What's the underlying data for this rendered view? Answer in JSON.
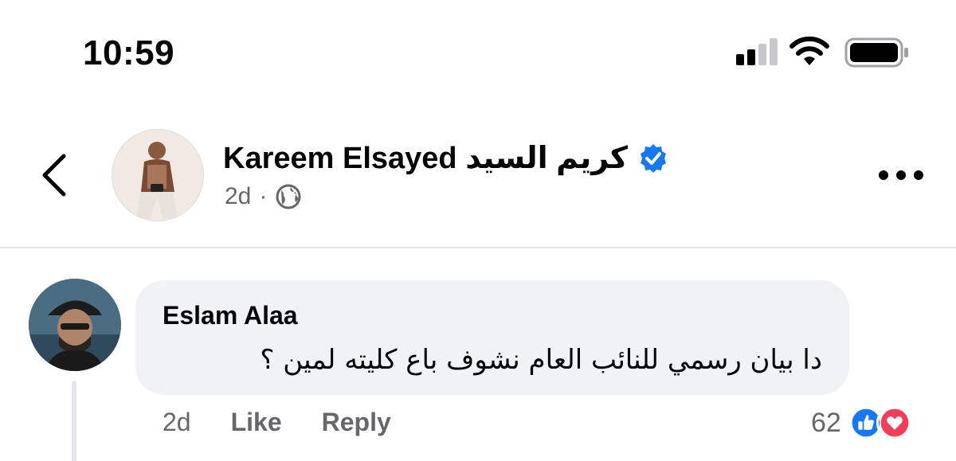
{
  "status_bar": {
    "time": "10:59"
  },
  "post": {
    "author_name": "Kareem Elsayed كريم  السيد",
    "timestamp": "2d",
    "separator": "·",
    "privacy_icon": "globe-icon",
    "verified_icon": "verified-badge-icon"
  },
  "comment": {
    "author_name": "Eslam Alaa",
    "text": "دا بيان رسمي للنائب العام نشوف باع كليته لمين ؟",
    "timestamp": "2d",
    "like_label": "Like",
    "reply_label": "Reply",
    "reaction_count": "62",
    "reactions": [
      "like",
      "love"
    ]
  },
  "colors": {
    "facebook_blue": "#1877f2",
    "love_red": "#f33e58",
    "secondary_text": "#65676b",
    "bubble_bg": "#f0f2f5"
  }
}
